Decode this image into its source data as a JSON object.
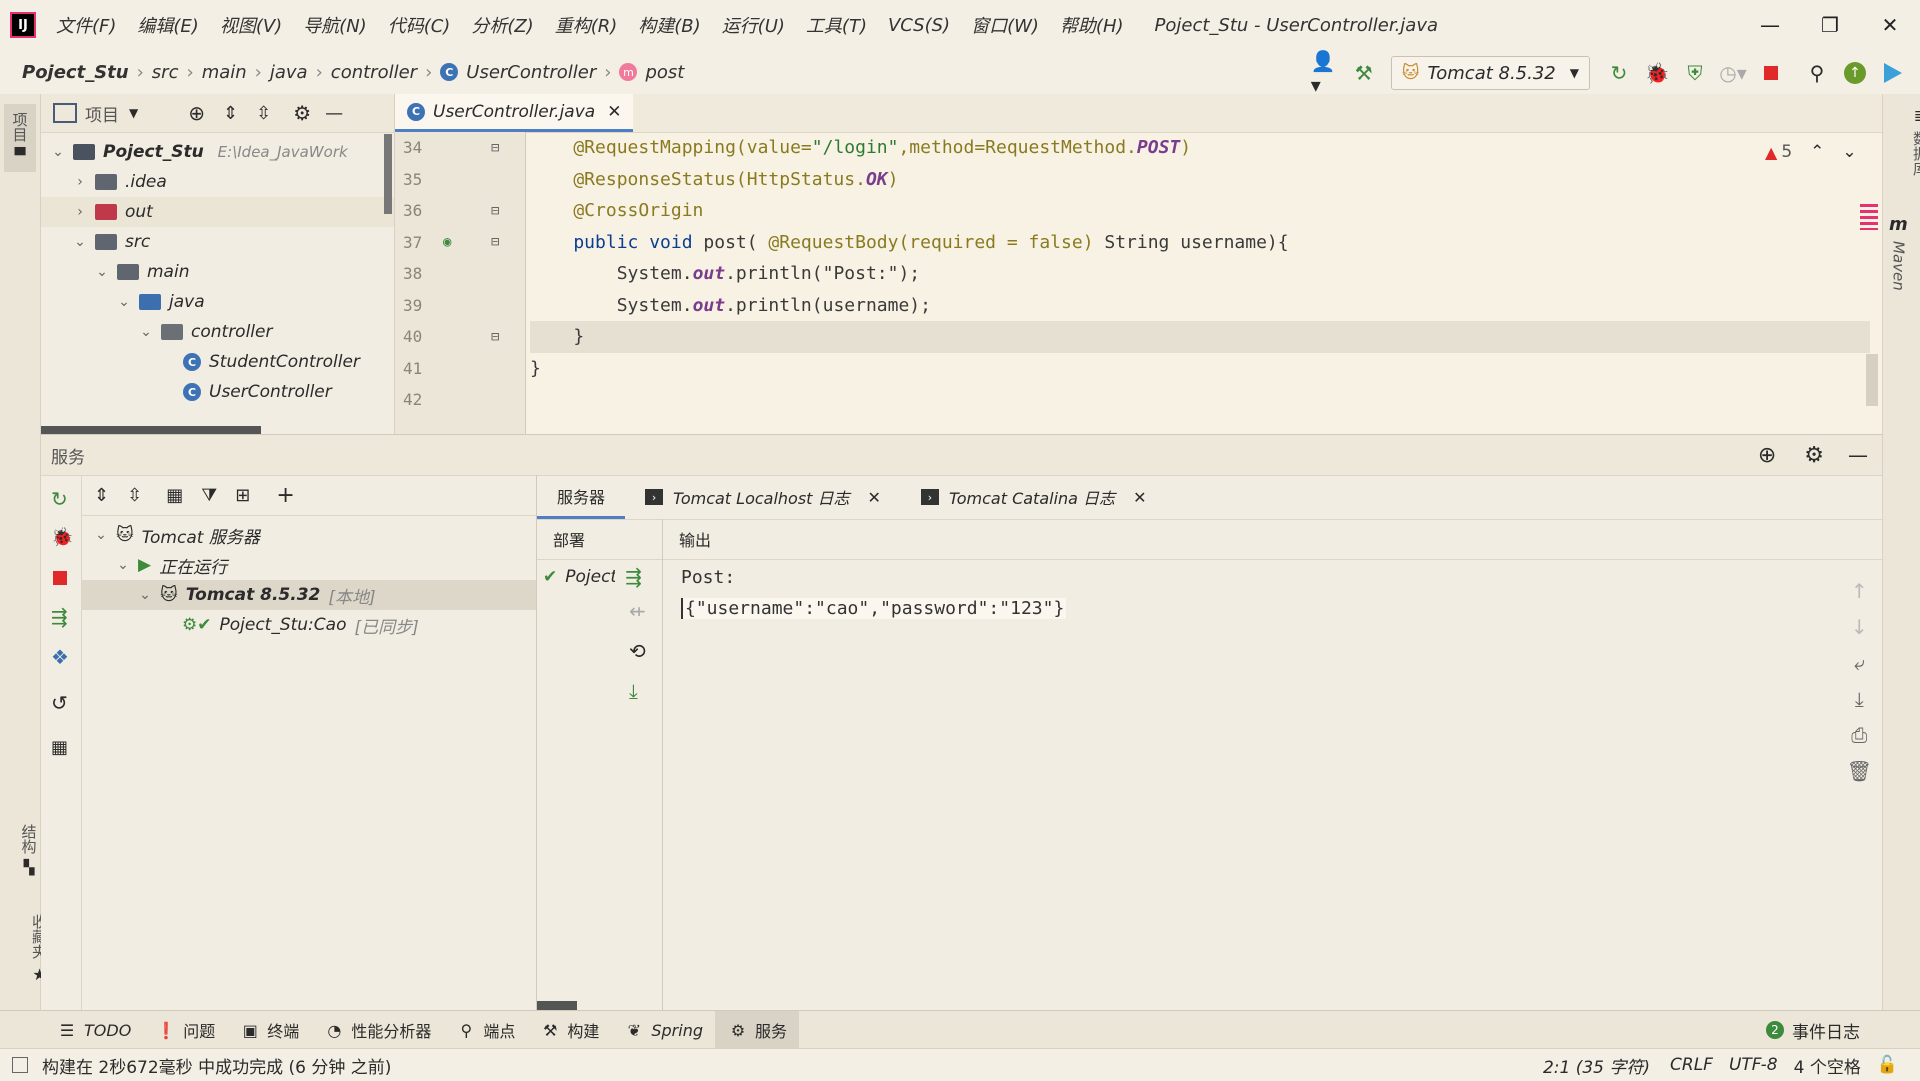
{
  "app": {
    "logo": "IJ",
    "window_title": "Poject_Stu - UserController.java",
    "menu": [
      "文件(F)",
      "编辑(E)",
      "视图(V)",
      "导航(N)",
      "代码(C)",
      "分析(Z)",
      "重构(R)",
      "构建(B)",
      "运行(U)",
      "工具(T)",
      "VCS(S)",
      "窗口(W)",
      "帮助(H)"
    ],
    "win_controls": {
      "minimize": "—",
      "restore": "❐",
      "close": "✕"
    }
  },
  "nav": {
    "breadcrumb": [
      "Poject_Stu",
      "src",
      "main",
      "java",
      "controller",
      "UserController",
      "post"
    ],
    "run_config": "Tomcat 8.5.32"
  },
  "left_stripe": {
    "project": "项目",
    "structure": "结构",
    "favorites": "收藏夹"
  },
  "right_stripe": {
    "database": "数据库",
    "maven": "Maven"
  },
  "project": {
    "title": "项目",
    "tree": [
      {
        "label": "Poject_Stu",
        "hint": "E:\\Idea_JavaWork",
        "depth": 0,
        "chev": "⌄",
        "icon": "module"
      },
      {
        "label": ".idea",
        "depth": 1,
        "chev": "›",
        "icon": "folder"
      },
      {
        "label": "out",
        "depth": 1,
        "chev": "›",
        "icon": "folder-red"
      },
      {
        "label": "src",
        "depth": 1,
        "chev": "⌄",
        "icon": "folder"
      },
      {
        "label": "main",
        "depth": 2,
        "chev": "⌄",
        "icon": "folder"
      },
      {
        "label": "java",
        "depth": 3,
        "chev": "⌄",
        "icon": "folder-blue"
      },
      {
        "label": "controller",
        "depth": 4,
        "chev": "⌄",
        "icon": "package"
      },
      {
        "label": "StudentController",
        "depth": 5,
        "chev": "",
        "icon": "class"
      },
      {
        "label": "UserController",
        "depth": 5,
        "chev": "",
        "icon": "class"
      }
    ]
  },
  "editor": {
    "tab": "UserController.java",
    "tab_close": "✕",
    "warnings": "5",
    "lines": [
      {
        "n": "34",
        "code": [
          {
            "t": "    @RequestMapping(value=",
            "c": "ann"
          },
          {
            "t": "\"/login\"",
            "c": "str"
          },
          {
            "t": ",method=RequestMethod.",
            "c": "ann"
          },
          {
            "t": "POST",
            "c": "cst"
          },
          {
            "t": ")",
            "c": "ann"
          }
        ]
      },
      {
        "n": "35",
        "code": [
          {
            "t": "    @ResponseStatus(HttpStatus.",
            "c": "ann"
          },
          {
            "t": "OK",
            "c": "cst"
          },
          {
            "t": ")",
            "c": "ann"
          }
        ]
      },
      {
        "n": "36",
        "code": [
          {
            "t": "    @CrossOrigin",
            "c": "ann"
          }
        ]
      },
      {
        "n": "37",
        "code": [
          {
            "t": "    public void ",
            "c": "kw"
          },
          {
            "t": "post( ",
            "c": ""
          },
          {
            "t": "@RequestBody(required = false) ",
            "c": "ann"
          },
          {
            "t": "String username){",
            "c": ""
          }
        ]
      },
      {
        "n": "38",
        "code": [
          {
            "t": "        System.",
            "c": ""
          },
          {
            "t": "out",
            "c": "fld"
          },
          {
            "t": ".println(\"Post:\");",
            "c": ""
          }
        ]
      },
      {
        "n": "39",
        "code": [
          {
            "t": "        System.",
            "c": ""
          },
          {
            "t": "out",
            "c": "fld"
          },
          {
            "t": ".println(username);",
            "c": ""
          }
        ]
      },
      {
        "n": "40",
        "code": [
          {
            "t": "    }",
            "c": ""
          }
        ],
        "hl": true
      },
      {
        "n": "41",
        "code": [
          {
            "t": "}",
            "c": ""
          }
        ]
      },
      {
        "n": "42",
        "code": [
          {
            "t": "",
            "c": ""
          }
        ]
      }
    ]
  },
  "services": {
    "title": "服务",
    "tree": [
      {
        "label": "Tomcat 服务器",
        "depth": 0,
        "chev": "⌄",
        "icon": "tomcat"
      },
      {
        "label": "正在运行",
        "depth": 1,
        "chev": "⌄",
        "icon": "run"
      },
      {
        "label": "Tomcat 8.5.32",
        "tag": "[本地]",
        "depth": 2,
        "chev": "⌄",
        "icon": "tomcat",
        "selected": true
      },
      {
        "label": "Poject_Stu:Cao",
        "tag": "[已同步]",
        "depth": 3,
        "chev": "",
        "icon": "artifact"
      }
    ],
    "tabs": [
      {
        "label": "服务器",
        "active": true,
        "closable": false
      },
      {
        "label": "Tomcat Localhost 日志",
        "active": false,
        "closable": true
      },
      {
        "label": "Tomcat Catalina 日志",
        "active": false,
        "closable": true
      }
    ],
    "deploy_header": "部署",
    "deploy_item": "Poject",
    "output_header": "输出",
    "output_lines": [
      "Post:",
      "{\"username\":\"cao\",\"password\":\"123\"}"
    ]
  },
  "bottom_tools": [
    {
      "label": "TODO",
      "icon": "☰"
    },
    {
      "label": "问题",
      "icon": "❗"
    },
    {
      "label": "终端",
      "icon": "▣"
    },
    {
      "label": "性能分析器",
      "icon": "◔"
    },
    {
      "label": "端点",
      "icon": "⚲"
    },
    {
      "label": "构建",
      "icon": "⚒"
    },
    {
      "label": "Spring",
      "icon": "❦"
    },
    {
      "label": "服务",
      "icon": "⚙",
      "active": true
    }
  ],
  "event_log": {
    "count": "2",
    "label": "事件日志"
  },
  "status": {
    "message": "构建在 2秒672毫秒 中成功完成 (6 分钟 之前)",
    "position": "2:1 (35 字符)",
    "line_sep": "CRLF",
    "encoding": "UTF-8",
    "indent": "4 个空格"
  }
}
